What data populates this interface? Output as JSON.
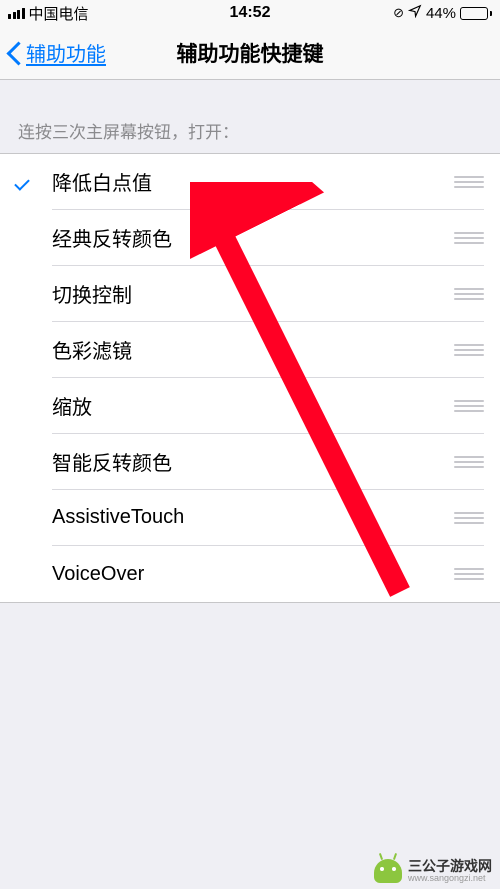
{
  "status_bar": {
    "carrier": "中国电信",
    "time": "14:52",
    "battery_percent": "44%"
  },
  "nav": {
    "back_label": "辅助功能",
    "title": "辅助功能快捷键"
  },
  "section_header": "连按三次主屏幕按钮，打开：",
  "items": [
    {
      "label": "降低白点值",
      "checked": true
    },
    {
      "label": "经典反转颜色",
      "checked": false
    },
    {
      "label": "切换控制",
      "checked": false
    },
    {
      "label": "色彩滤镜",
      "checked": false
    },
    {
      "label": "缩放",
      "checked": false
    },
    {
      "label": "智能反转颜色",
      "checked": false
    },
    {
      "label": "AssistiveTouch",
      "checked": false
    },
    {
      "label": "VoiceOver",
      "checked": false
    }
  ],
  "annotation": {
    "arrow_color": "#ff0024"
  },
  "watermark": {
    "name": "三公子游戏网",
    "url": "www.sangongzi.net"
  }
}
